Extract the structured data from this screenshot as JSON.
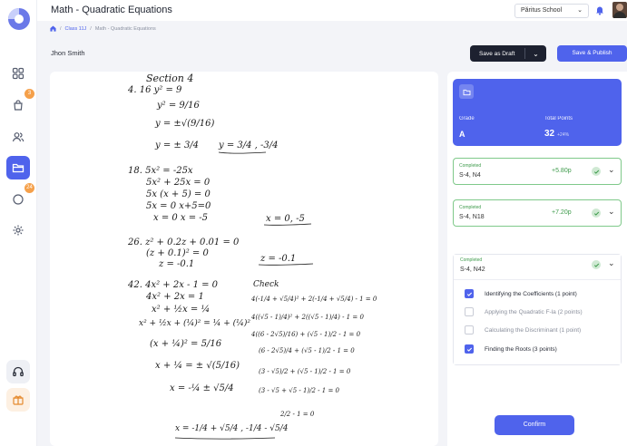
{
  "header": {
    "title": "Math - Quadratic Equations",
    "school": "Păritus School"
  },
  "breadcrumb": {
    "class": "Class 11J",
    "separator": "/",
    "current": "Math - Quadratic Equations"
  },
  "student": {
    "name": "Jhon Smith"
  },
  "actions": {
    "draft": "Save as Draft",
    "publish": "Save & Publish"
  },
  "sidebar": {
    "badges": {
      "assignments": "3",
      "messages": "24"
    }
  },
  "score": {
    "grade_label": "Grade",
    "grade": "A",
    "points_label": "Total Points",
    "points": "32",
    "delta": "+24%"
  },
  "questions": [
    {
      "status": "Completed",
      "name": "S-4, N4",
      "points": "+5.80p"
    },
    {
      "status": "Completed",
      "name": "S-4, N18",
      "points": "+7.20p"
    },
    {
      "status": "Completed",
      "name": "S-4, N42"
    }
  ],
  "criteria": [
    {
      "label": "Identifying the Coefficients (1 point)",
      "checked": true
    },
    {
      "label": "Applying the Quadratic F-la (2 points)",
      "checked": false
    },
    {
      "label": "Calculating the Discriminant (1 point)",
      "checked": false
    },
    {
      "label": "Finding the Roots (3 points)",
      "checked": true
    }
  ],
  "confirm": "Confirm",
  "handwriting": [
    "Section 4",
    "4.  16 y² = 9",
    "y² = 9/16",
    "y = ±√(9/16)",
    "y = ± 3/4",
    "y = 3/4 , -3/4",
    "18.  5x² = -25x",
    "5x² + 25x = 0",
    "5x (x + 5) = 0",
    "5x = 0     x+5=0",
    "x = 0     x = -5",
    "x = 0, -5",
    "26.  z² + 0.2z + 0.01 = 0",
    "(z + 0.1)² = 0",
    "z = -0.1",
    "z = -0.1",
    "42.  4x² + 2x - 1 = 0",
    "4x² + 2x = 1",
    "x² + ½x = ¼",
    "x² + ½x + (¼)² = ¼ + (¼)²",
    "(x + ¼)² = 5/16",
    "x + ¼ = ± √(5/16)",
    "x = -¼ ± √5/4",
    "x = -1/4 + √5/4 , -1/4 - √5/4",
    "Check",
    "4(-1/4 + √5/4)² + 2(-1/4 + √5/4) - 1 = 0",
    "4((√5 - 1)/4)² + 2((√5 - 1)/4) - 1 = 0",
    "4((6 - 2√5)/16) + (√5 - 1)/2 - 1 = 0",
    "(6 - 2√5)/4 + (√5 - 1)/2 - 1 = 0",
    "(3 - √5)/2 + (√5 - 1)/2 - 1 = 0",
    "(3 - √5 + √5 - 1)/2 - 1 = 0",
    "2/2 - 1 = 0"
  ]
}
